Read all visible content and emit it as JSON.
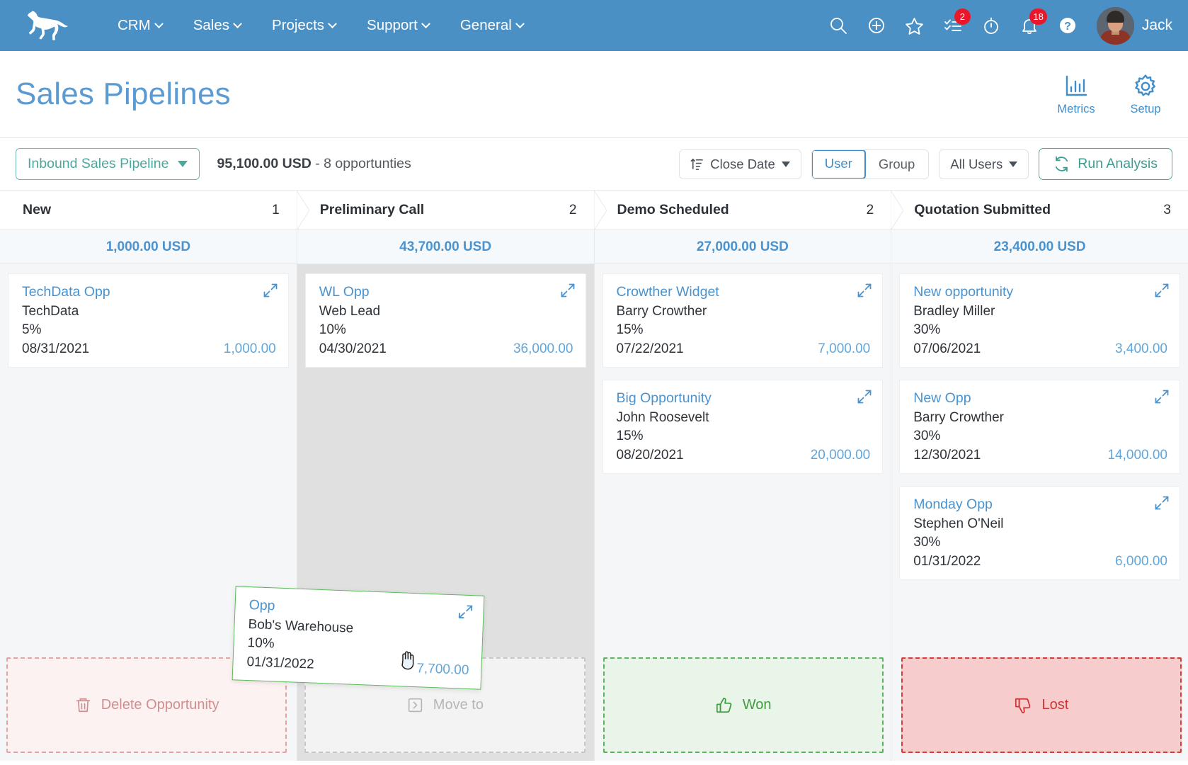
{
  "topnav": {
    "logo": "greyhound-logo",
    "menus": [
      {
        "label": "CRM",
        "icon": "chevron-down-icon"
      },
      {
        "label": "Sales",
        "icon": "chevron-down-icon"
      },
      {
        "label": "Projects",
        "icon": "chevron-down-icon"
      },
      {
        "label": "Support",
        "icon": "chevron-down-icon"
      },
      {
        "label": "General",
        "icon": "chevron-down-icon"
      }
    ],
    "icons": [
      {
        "name": "search-icon",
        "badge": null
      },
      {
        "name": "add-circle-icon",
        "badge": null
      },
      {
        "name": "star-icon",
        "badge": null
      },
      {
        "name": "tasks-checklist-icon",
        "badge": "2"
      },
      {
        "name": "timer-icon",
        "badge": null
      },
      {
        "name": "notifications-bell-icon",
        "badge": "18"
      },
      {
        "name": "help-icon",
        "badge": null
      }
    ],
    "user": {
      "name": "Jack",
      "avatar": "user-avatar"
    }
  },
  "header": {
    "title": "Sales Pipelines",
    "actions": [
      {
        "label": "Metrics",
        "icon": "bar-chart-icon"
      },
      {
        "label": "Setup",
        "icon": "gear-icon"
      }
    ]
  },
  "toolbar": {
    "pipeline_selector": {
      "label": "Inbound Sales Pipeline",
      "icon": "caret-down-icon"
    },
    "summary_amount": "95,100.00 USD",
    "summary_rest": " - 8 opportunties",
    "sort": {
      "label": "Close Date",
      "icon": "sort-ascending-icon",
      "caret": "caret-down-icon"
    },
    "view_toggle": {
      "options": [
        "User",
        "Group"
      ],
      "selected": "User"
    },
    "user_filter": {
      "label": "All Users",
      "icon": "caret-down-icon"
    },
    "run_analysis": {
      "label": "Run Analysis",
      "icon": "refresh-icon"
    }
  },
  "board": {
    "columns": [
      {
        "name": "New",
        "count": "1",
        "total": "1,000.00 USD",
        "drop_active": false,
        "cards": [
          {
            "title": "TechData Opp",
            "contact": "TechData",
            "probability": "5%",
            "date": "08/31/2021",
            "amount": "1,000.00"
          }
        ]
      },
      {
        "name": "Preliminary Call",
        "count": "2",
        "total": "43,700.00 USD",
        "drop_active": true,
        "cards": [
          {
            "title": "WL Opp",
            "contact": "Web Lead",
            "probability": "10%",
            "date": "04/30/2021",
            "amount": "36,000.00"
          }
        ]
      },
      {
        "name": "Demo Scheduled",
        "count": "2",
        "total": "27,000.00 USD",
        "drop_active": false,
        "cards": [
          {
            "title": "Crowther Widget",
            "contact": "Barry Crowther",
            "probability": "15%",
            "date": "07/22/2021",
            "amount": "7,000.00"
          },
          {
            "title": "Big Opportunity",
            "contact": "John Roosevelt",
            "probability": "15%",
            "date": "08/20/2021",
            "amount": "20,000.00"
          }
        ]
      },
      {
        "name": "Quotation Submitted",
        "count": "3",
        "total": "23,400.00 USD",
        "drop_active": false,
        "cards": [
          {
            "title": "New opportunity",
            "contact": "Bradley Miller",
            "probability": "30%",
            "date": "07/06/2021",
            "amount": "3,400.00"
          },
          {
            "title": "New Opp",
            "contact": "Barry Crowther",
            "probability": "30%",
            "date": "12/30/2021",
            "amount": "14,000.00"
          },
          {
            "title": "Monday Opp",
            "contact": "Stephen O'Neil",
            "probability": "30%",
            "date": "01/31/2022",
            "amount": "6,000.00"
          }
        ]
      }
    ],
    "dragging_card": {
      "title": "Opp",
      "contact": "Bob's Warehouse",
      "probability": "10%",
      "date": "01/31/2022",
      "amount": "7,700.00"
    }
  },
  "dropzones": [
    {
      "label": "Delete Opportunity",
      "icon": "trash-icon",
      "kind": "delete"
    },
    {
      "label": "Move to",
      "icon": "move-to-icon",
      "kind": "move"
    },
    {
      "label": "Won",
      "icon": "thumbs-up-icon",
      "kind": "won"
    },
    {
      "label": "Lost",
      "icon": "thumbs-down-icon",
      "kind": "lost"
    }
  ],
  "colors": {
    "nav_blue": "#4a90c4",
    "link_blue": "#4a93cf",
    "teal": "#4aa89c",
    "badge_red": "#e8172a",
    "won_green": "#3f9b3f",
    "lost_red": "#cc3333"
  }
}
